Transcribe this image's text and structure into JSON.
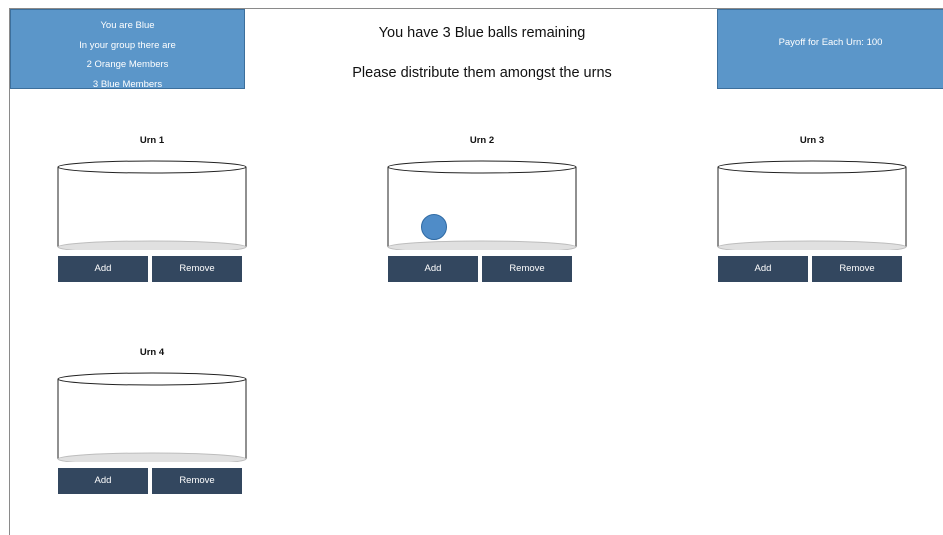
{
  "info": {
    "line1": "You are Blue",
    "line2": "In your group there are",
    "line3": "2 Orange Members",
    "line4": "3 Blue Members"
  },
  "headline": {
    "remaining": "You have 3 Blue balls remaining",
    "instruction": "Please distribute them amongst the urns"
  },
  "payoff": {
    "label": "Payoff for Each Urn: 100"
  },
  "colors": {
    "info_box": "#5b96c9",
    "button": "#33475f",
    "ball": "#4f8cc8"
  },
  "urns": [
    {
      "title": "Urn 1",
      "add_label": "Add",
      "remove_label": "Remove",
      "balls": 0
    },
    {
      "title": "Urn 2",
      "add_label": "Add",
      "remove_label": "Remove",
      "balls": 1
    },
    {
      "title": "Urn 3",
      "add_label": "Add",
      "remove_label": "Remove",
      "balls": 0
    },
    {
      "title": "Urn 4",
      "add_label": "Add",
      "remove_label": "Remove",
      "balls": 0
    }
  ]
}
